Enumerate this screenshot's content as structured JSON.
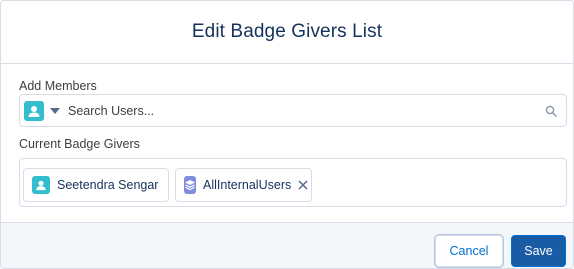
{
  "modal": {
    "title": "Edit Badge Givers List"
  },
  "add_members": {
    "label": "Add Members",
    "search_placeholder": "Search Users..."
  },
  "current_givers": {
    "label": "Current Badge Givers",
    "pills": [
      {
        "label": "Seetendra Sengar",
        "icon": "user-icon",
        "removable": false
      },
      {
        "label": "AllInternalUsers",
        "icon": "group-icon",
        "removable": true
      }
    ]
  },
  "footer": {
    "cancel_label": "Cancel",
    "save_label": "Save"
  },
  "colors": {
    "brand": "#0070d2",
    "user_icon": "#34becd",
    "group_icon": "#7f8de1"
  }
}
